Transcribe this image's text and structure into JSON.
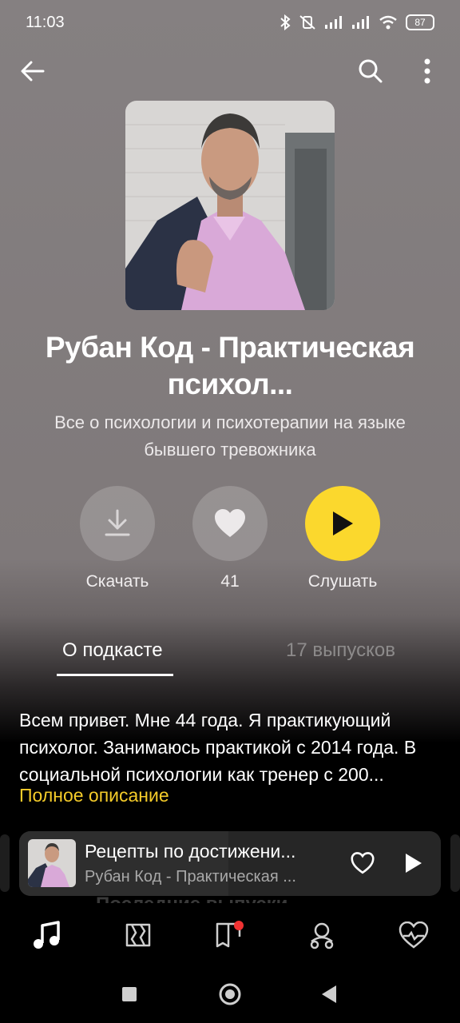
{
  "status": {
    "time": "11:03",
    "battery": "87"
  },
  "podcast": {
    "title": "Рубан Код - Практическая психол...",
    "subtitle": "Все о психологии и психотерапии на языке бывшего тревожника",
    "cover_icon": "podcast-cover-photo"
  },
  "actions": {
    "download_label": "Скачать",
    "likes_count": "41",
    "listen_label": "Слушать"
  },
  "tabs": {
    "about": "О подкасте",
    "episodes": "17 выпусков"
  },
  "description": {
    "text": "Всем привет. Мне 44 года. Я практикующий психолог. Занимаюсь практикой с 2014 года. В социальной психологии как тренер с 200...",
    "more_link": "Полное описание"
  },
  "hidden_section_title": "Последние выпуски",
  "miniplayer": {
    "title": "Рецепты по достижени...",
    "subtitle": "Рубан Код - Практическая ..."
  },
  "colors": {
    "accent": "#fbd82d",
    "link": "#f5cc2a",
    "background": "#858081"
  },
  "icons": {
    "back": "arrow-left-icon",
    "search": "search-icon",
    "menu": "more-vert-icon",
    "download": "download-icon",
    "like": "heart-icon",
    "play": "play-icon",
    "nav": [
      "music-note-icon",
      "map-icon",
      "book-icon",
      "kids-icon",
      "heart-wave-icon"
    ]
  }
}
